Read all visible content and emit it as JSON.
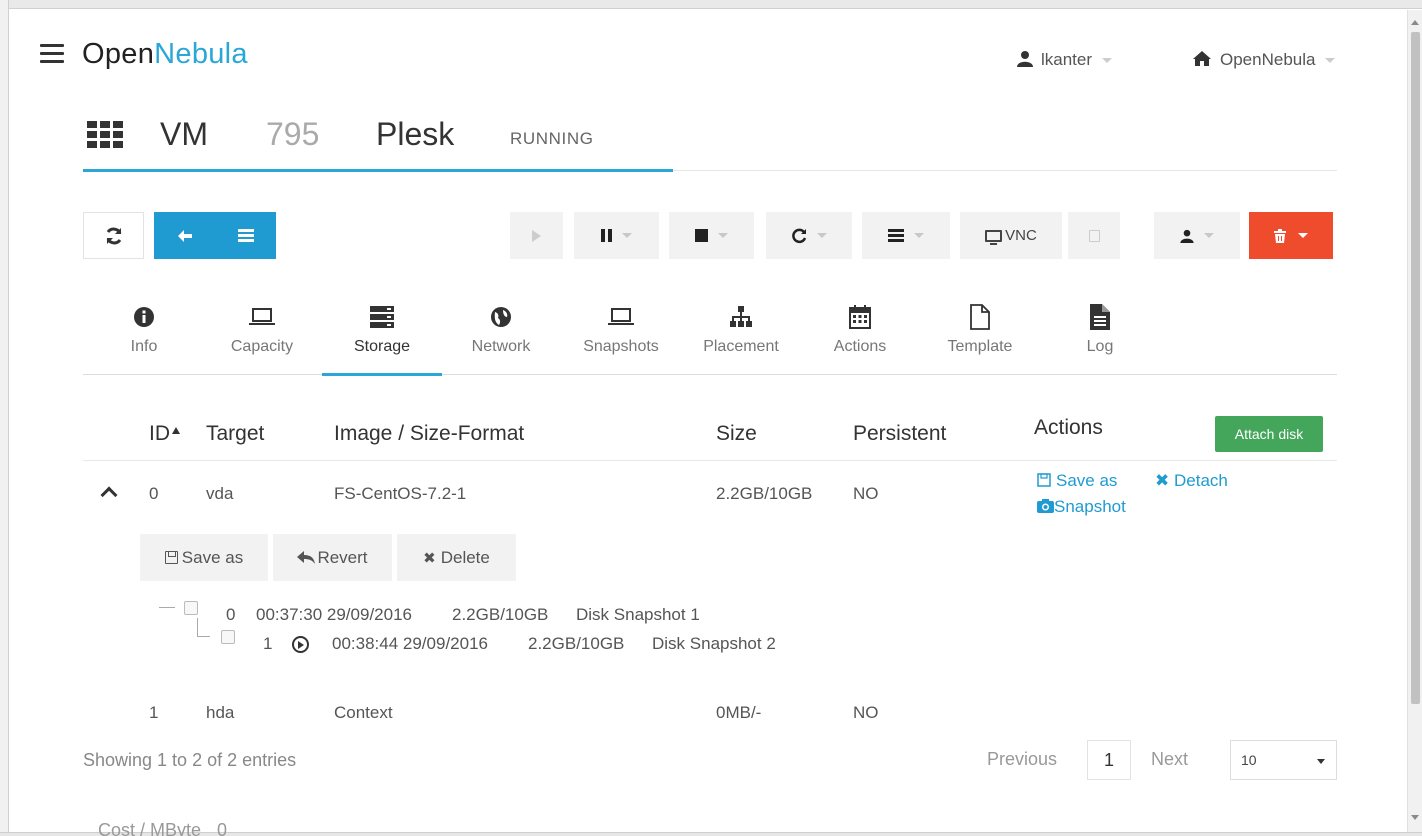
{
  "header": {
    "logo_open": "Open",
    "logo_nebula": "Nebula",
    "user": "lkanter",
    "zone": "OpenNebula"
  },
  "vm": {
    "label": "VM",
    "id": "795",
    "name": "Plesk",
    "state": "RUNNING"
  },
  "toolbar": {
    "vnc_label": "VNC"
  },
  "tabs": [
    {
      "label": "Info"
    },
    {
      "label": "Capacity"
    },
    {
      "label": "Storage"
    },
    {
      "label": "Network"
    },
    {
      "label": "Snapshots"
    },
    {
      "label": "Placement"
    },
    {
      "label": "Actions"
    },
    {
      "label": "Template"
    },
    {
      "label": "Log"
    }
  ],
  "table": {
    "headers": {
      "id": "ID",
      "target": "Target",
      "image": "Image / Size-Format",
      "size": "Size",
      "persistent": "Persistent",
      "actions": "Actions"
    },
    "attach_label": "Attach disk",
    "rows": [
      {
        "id": "0",
        "target": "vda",
        "image": "FS-CentOS-7.2-1",
        "size": "2.2GB/10GB",
        "persistent": "NO"
      },
      {
        "id": "1",
        "target": "hda",
        "image": "Context",
        "size": "0MB/-",
        "persistent": "NO"
      }
    ],
    "row_actions": {
      "save_as": "Save as",
      "detach": "Detach",
      "snapshot": "Snapshot"
    },
    "snapshot_buttons": {
      "save_as": "Save as",
      "revert": "Revert",
      "delete": "Delete"
    },
    "snapshots": [
      {
        "id": "0",
        "time": "00:37:30 29/09/2016",
        "size": "2.2GB/10GB",
        "name": "Disk Snapshot 1"
      },
      {
        "id": "1",
        "time": "00:38:44 29/09/2016",
        "size": "2.2GB/10GB",
        "name": "Disk Snapshot 2"
      }
    ]
  },
  "footer": {
    "info": "Showing 1 to 2 of 2 entries",
    "previous": "Previous",
    "current_page": "1",
    "next": "Next",
    "page_size": "10"
  },
  "cost": {
    "label": "Cost / MByte",
    "value": "0"
  }
}
